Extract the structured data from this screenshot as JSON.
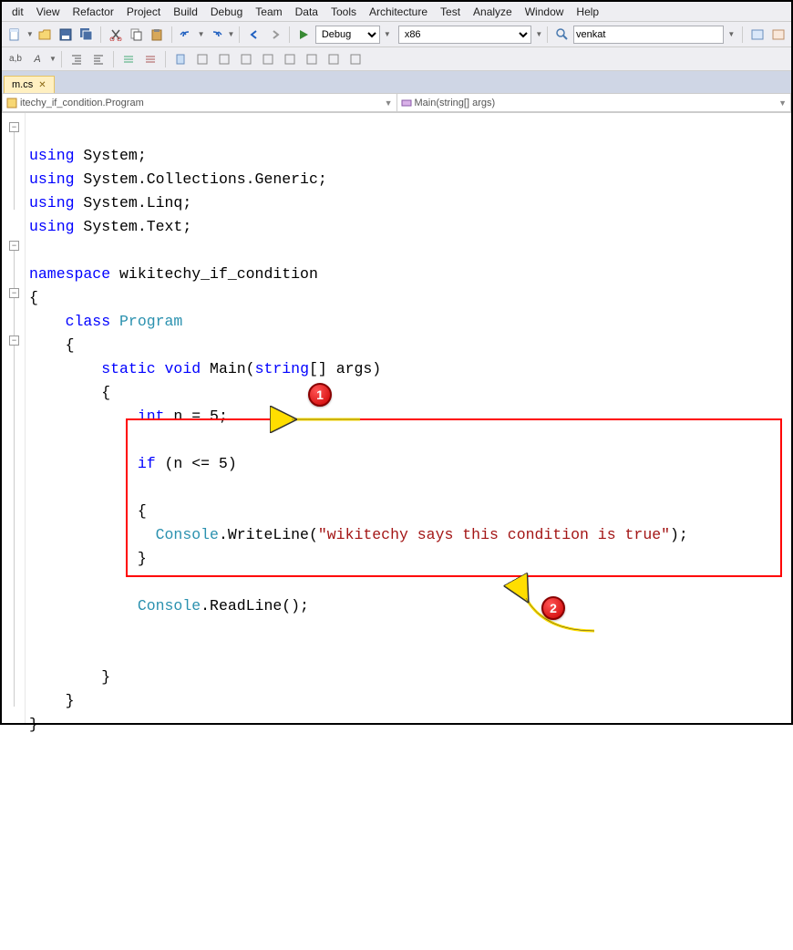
{
  "menu": [
    "dit",
    "View",
    "Refactor",
    "Project",
    "Build",
    "Debug",
    "Team",
    "Data",
    "Tools",
    "Architecture",
    "Test",
    "Analyze",
    "Window",
    "Help"
  ],
  "toolbar": {
    "config": "Debug",
    "platform": "x86",
    "search": "venkat"
  },
  "tab": {
    "name": "m.cs",
    "close": "✕"
  },
  "nav": {
    "left": "itechy_if_condition.Program",
    "right": "Main(string[] args)"
  },
  "code": {
    "l1a": "using",
    "l1b": " System;",
    "l2a": "using",
    "l2b": " System.Collections.Generic;",
    "l3a": "using",
    "l3b": " System.Linq;",
    "l4a": "using",
    "l4b": " System.Text;",
    "l6a": "namespace",
    "l6b": " wikitechy_if_condition",
    "l7": "{",
    "l8a": "    class",
    "l8b": " Program",
    "l9": "    {",
    "l10a": "        static",
    "l10b": " void",
    "l10c": " Main(",
    "l10d": "string",
    "l10e": "[] args)",
    "l11": "        {",
    "l12a": "            int",
    "l12b": " n = 5;",
    "l14a": "            if",
    "l14b": " (n <= 5)",
    "l16": "            {",
    "l17a": "              Console",
    "l17b": ".WriteLine(",
    "l17c": "\"wikitechy says this condition is true\"",
    "l17d": ");",
    "l18": "            }",
    "l20a": "            Console",
    "l20b": ".ReadLine();",
    "l23": "        }",
    "l24": "    }",
    "l25": "}"
  },
  "badges": {
    "one": "1",
    "two": "2"
  }
}
